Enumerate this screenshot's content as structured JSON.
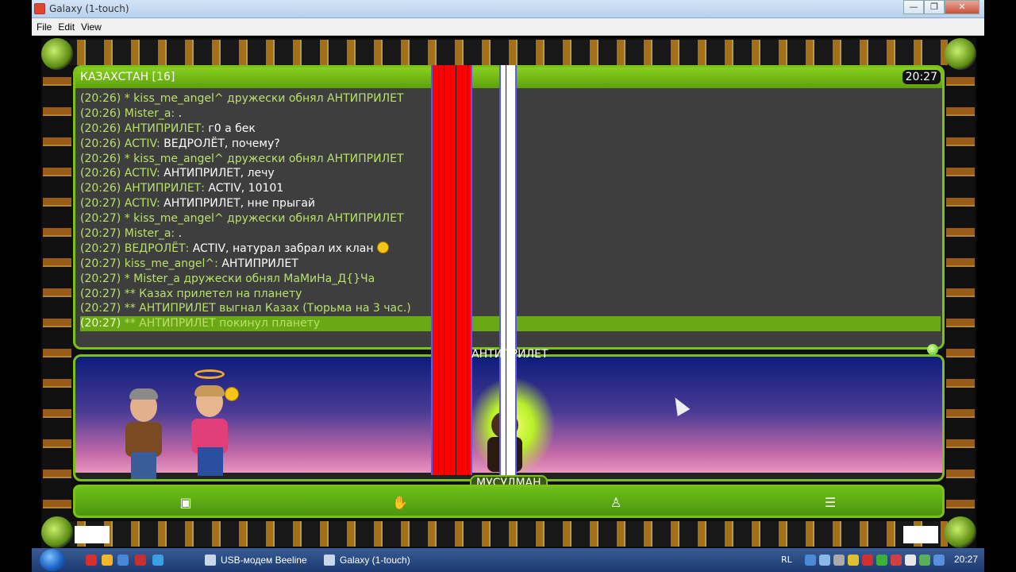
{
  "window": {
    "title": "Galaxy (1-touch)"
  },
  "menu": [
    "File",
    "Edit",
    "View"
  ],
  "chat": {
    "room": "КАЗАХСТАН [16]",
    "time": "20:27",
    "messages": [
      {
        "time": "(20:26)",
        "nick": "* kiss_me_angel^ дружески обнял АНТИПРИЛЕТ",
        "text": "",
        "type": "action"
      },
      {
        "time": "(20:26)",
        "nick": "Mister_a:",
        "text": ".",
        "type": "msg"
      },
      {
        "time": "(20:26)",
        "nick": "АНТИПРИЛЕТ:",
        "text": "г0 а бек",
        "type": "msg"
      },
      {
        "time": "(20:26)",
        "nick": "ACTIV:",
        "text": "ВЕДРОЛЁТ, почему?",
        "type": "msg"
      },
      {
        "time": "(20:26)",
        "nick": "* kiss_me_angel^ дружески обнял АНТИПРИЛЕТ",
        "text": "",
        "type": "action"
      },
      {
        "time": "(20:26)",
        "nick": "ACTIV:",
        "text": "АНТИПРИЛЕТ, лечу",
        "type": "msg"
      },
      {
        "time": "(20:26)",
        "nick": "АНТИПРИЛЕТ:",
        "text": "ACTIV, 10101",
        "type": "msg"
      },
      {
        "time": "(20:27)",
        "nick": "ACTIV:",
        "text": "АНТИПРИЛЕТ, нне прыгай",
        "type": "msg"
      },
      {
        "time": "(20:27)",
        "nick": "* kiss_me_angel^ дружески обнял АНТИПРИЛЕТ",
        "text": "",
        "type": "action"
      },
      {
        "time": "(20:27)",
        "nick": "Mister_a:",
        "text": ".",
        "type": "msg"
      },
      {
        "time": "(20:27)",
        "nick": "ВЕДРОЛЁТ:",
        "text": "ACTIV, натурал забрал их клан",
        "type": "msg",
        "emoji": true
      },
      {
        "time": "(20:27)",
        "nick": "kiss_me_angel^:",
        "text": "АНТИПРИЛЕТ",
        "type": "msg"
      },
      {
        "time": "(20:27)",
        "nick": "* Mister_a дружески обнял МаМиНа_Д{}Ча",
        "text": "",
        "type": "action"
      },
      {
        "time": "(20:27)",
        "nick": "** Казах прилетел на планету",
        "text": "",
        "type": "action"
      },
      {
        "time": "(20:27)",
        "nick": "** АНТИПРИЛЕТ выгнал Казах (Тюрьма на 3 час.)",
        "text": "",
        "type": "action"
      },
      {
        "time": "(20:27)",
        "nick": "** АНТИПРИЛЕТ покинул планету",
        "text": "",
        "type": "highlight"
      }
    ]
  },
  "scene": {
    "name_top": "АНТИПРИЛЕТ",
    "name_bottom": "МУСУЛМАН"
  },
  "toolbar": {
    "icons": [
      "chat-bubble-icon",
      "hand-icon",
      "person-icon",
      "list-icon"
    ]
  },
  "taskbar": {
    "tasks": [
      "USB-модем Beeline",
      "Galaxy (1-touch)"
    ],
    "lang": "RL",
    "clock": "20:27"
  }
}
